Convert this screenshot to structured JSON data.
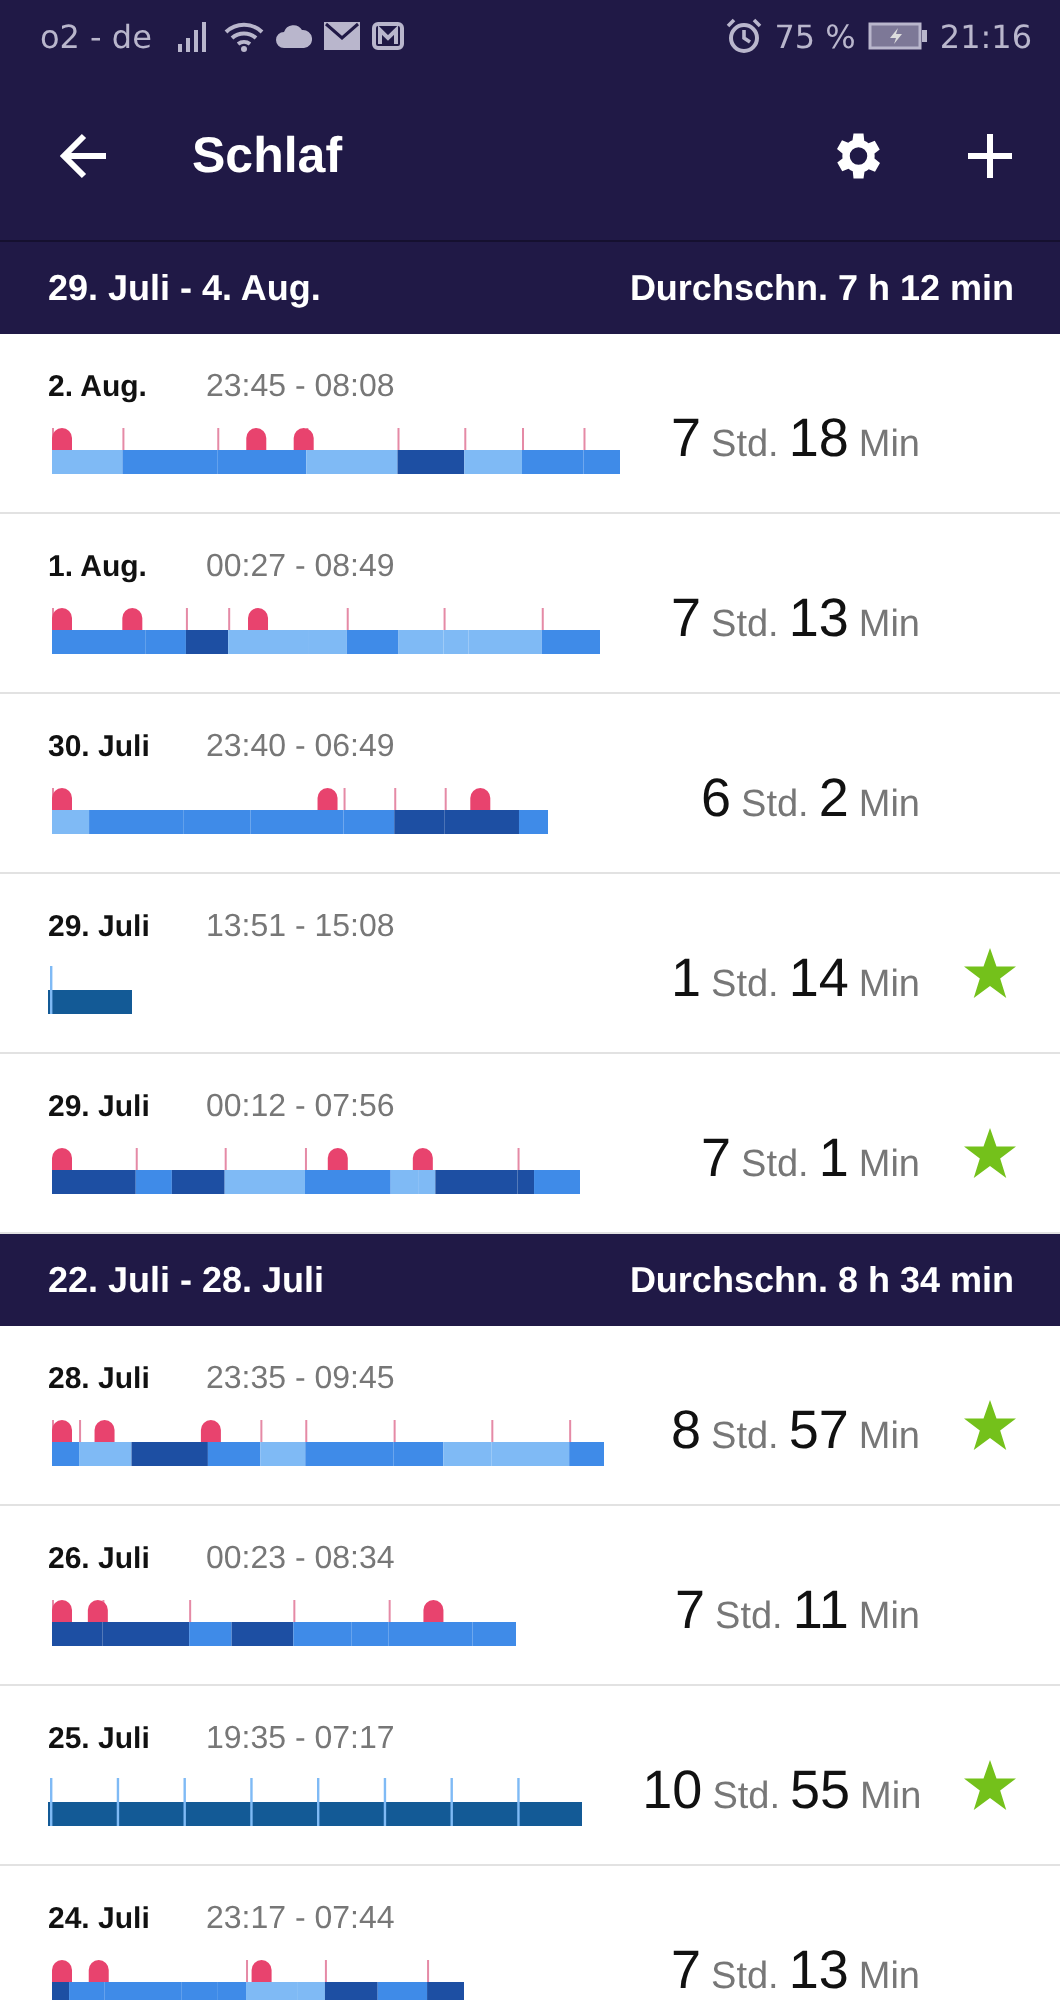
{
  "status_bar": {
    "carrier": "o2 - de",
    "battery": "75 %",
    "time": "21:16"
  },
  "app_bar": {
    "title": "Schlaf"
  },
  "weeks": [
    {
      "range": "29. Juli - 4. Aug.",
      "average": "Durchschn. 7 h 12 min",
      "entries": [
        {
          "date": "2. Aug.",
          "times": "23:45 - 08:08",
          "kind": "stages",
          "hours": "7",
          "hours_unit": "Std.",
          "minutes": "18",
          "minutes_unit": "Min",
          "starred": false
        },
        {
          "date": "1. Aug.",
          "times": "00:27 - 08:49",
          "kind": "stages",
          "hours": "7",
          "hours_unit": "Std.",
          "minutes": "13",
          "minutes_unit": "Min",
          "starred": false
        },
        {
          "date": "30. Juli",
          "times": "23:40 - 06:49",
          "kind": "stages",
          "hours": "6",
          "hours_unit": "Std.",
          "minutes": "2",
          "minutes_unit": "Min",
          "starred": false
        },
        {
          "date": "29. Juli",
          "times": "13:51 - 15:08",
          "kind": "classic",
          "hours": "1",
          "hours_unit": "Std.",
          "minutes": "14",
          "minutes_unit": "Min",
          "starred": true
        },
        {
          "date": "29. Juli",
          "times": "00:12 - 07:56",
          "kind": "stages",
          "hours": "7",
          "hours_unit": "Std.",
          "minutes": "1",
          "minutes_unit": "Min",
          "starred": true
        }
      ]
    },
    {
      "range": "22. Juli - 28. Juli",
      "average": "Durchschn. 8 h 34 min",
      "entries": [
        {
          "date": "28. Juli",
          "times": "23:35 - 09:45",
          "kind": "stages",
          "hours": "8",
          "hours_unit": "Std.",
          "minutes": "57",
          "minutes_unit": "Min",
          "starred": true
        },
        {
          "date": "26. Juli",
          "times": "00:23 - 08:34",
          "kind": "stages",
          "hours": "7",
          "hours_unit": "Std.",
          "minutes": "11",
          "minutes_unit": "Min",
          "starred": false
        },
        {
          "date": "25. Juli",
          "times": "19:35 - 07:17",
          "kind": "classic",
          "hours": "10",
          "hours_unit": "Std.",
          "minutes": "55",
          "minutes_unit": "Min",
          "starred": true
        },
        {
          "date": "24. Juli",
          "times": "23:17 - 07:44",
          "kind": "stages",
          "hours": "7",
          "hours_unit": "Std.",
          "minutes": "13",
          "minutes_unit": "Min",
          "starred": false
        }
      ]
    }
  ]
}
